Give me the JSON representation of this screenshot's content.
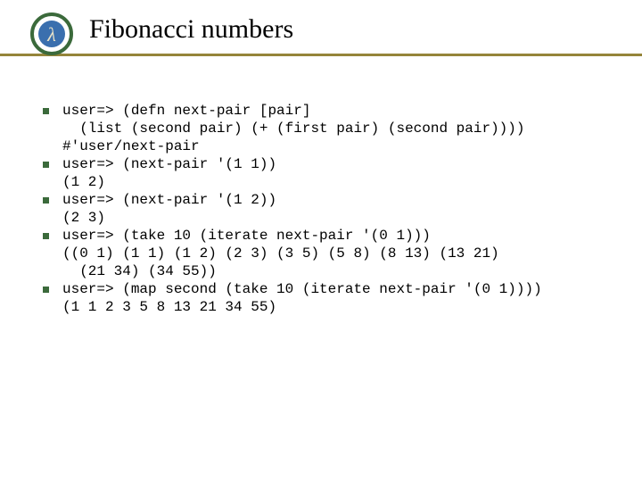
{
  "title": "Fibonacci numbers",
  "logo": {
    "outer_stroke": "#3b6a3b",
    "inner_fill": "#3a6fae"
  },
  "bullets": [
    "user=> (defn next-pair [pair]\n  (list (second pair) (+ (first pair) (second pair))))\n#'user/next-pair",
    "user=> (next-pair '(1 1))\n(1 2)",
    "user=> (next-pair '(1 2))\n(2 3)",
    "user=> (take 10 (iterate next-pair '(0 1)))\n((0 1) (1 1) (1 2) (2 3) (3 5) (5 8) (8 13) (13 21)\n  (21 34) (34 55))",
    "user=> (map second (take 10 (iterate next-pair '(0 1))))\n(1 1 2 3 5 8 13 21 34 55)"
  ]
}
